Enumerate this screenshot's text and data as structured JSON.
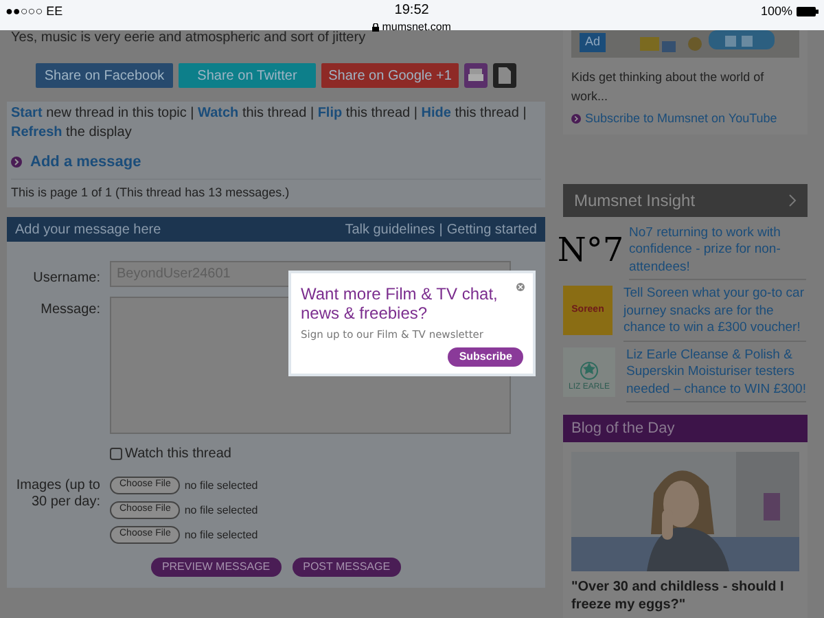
{
  "status_bar": {
    "carrier": "●●○○○ EE",
    "time": "19:52",
    "url": "mumsnet.com",
    "battery": "100%"
  },
  "intro_text": "Yes, music is very eerie and atmospheric and sort of jittery",
  "share_buttons": [
    {
      "label": "Share on Facebook",
      "color": "#274a6e"
    },
    {
      "label": "Share on Twitter",
      "color": "#0d7f8a"
    },
    {
      "label": "Share on Google +1",
      "color": "#8e2a26"
    }
  ],
  "thread_actions": [
    {
      "link": "Start",
      "text": " new thread in this topic"
    },
    {
      "link": "Watch",
      "text": " this thread"
    },
    {
      "link": "Flip",
      "text": " this thread"
    },
    {
      "link": "Hide",
      "text": " this thread"
    },
    {
      "link": "Refresh",
      "text": " the display"
    }
  ],
  "separator": "|",
  "add_message": "Add a message",
  "page_info": "This is page 1 of 1 (This thread has 13 messages.)",
  "form": {
    "header": "Add your message here",
    "header_links": [
      "Talk guidelines",
      "Getting started"
    ],
    "username_label": "Username:",
    "username_value": "BeyondUser24601",
    "message_label": "Message:",
    "watch_label": "Watch this thread",
    "watch_checked": false,
    "images_label": "Images (up to 30 per day:",
    "files": [
      {
        "button": "Choose File",
        "status": "no file selected"
      },
      {
        "button": "Choose File",
        "status": "no file selected"
      },
      {
        "button": "Choose File",
        "status": "no file selected"
      }
    ],
    "buttons": [
      "PREVIEW MESSAGE",
      "POST MESSAGE"
    ]
  },
  "popup": {
    "title": "Want more Film & TV chat, news & freebies?",
    "subtitle": "Sign up to our Film & TV newsletter",
    "button": "Subscribe"
  },
  "sidebar": {
    "ad_badge": "Ad",
    "ad_caption": "Kids get thinking about the world of work...",
    "ad_link": "Subscribe to Mumsnet on YouTube",
    "insight_title": "Mumsnet Insight",
    "insight_items": [
      {
        "kind": "no7",
        "logo": "N°7",
        "text": "No7 returning to work with confidence - prize for non-attendees!"
      },
      {
        "kind": "soreen",
        "logo": "Soreen",
        "text": "Tell Soreen what your go-to car journey snacks are for the chance to win a £300 voucher!"
      },
      {
        "kind": "lizearle",
        "logo": "LIZ EARLE",
        "text": "Liz Earle Cleanse & Polish & Superskin Moisturiser testers needed – chance to WIN £300!"
      }
    ],
    "blog_title": "Blog of the Day",
    "blog_post": "\"Over 30 and childless - should I freeze my eggs?\""
  }
}
